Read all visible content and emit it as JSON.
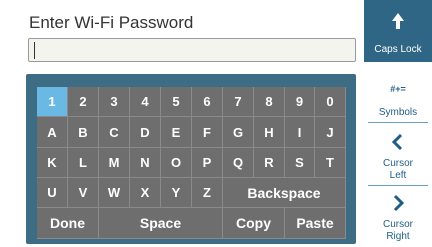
{
  "title": "Enter Wi-Fi Password",
  "password_value": "",
  "keyboard": {
    "row1": [
      "1",
      "2",
      "3",
      "4",
      "5",
      "6",
      "7",
      "8",
      "9",
      "0"
    ],
    "row2": [
      "A",
      "B",
      "C",
      "D",
      "E",
      "F",
      "G",
      "H",
      "I",
      "J"
    ],
    "row3": [
      "K",
      "L",
      "M",
      "N",
      "O",
      "P",
      "Q",
      "R",
      "S",
      "T"
    ],
    "row4": [
      "U",
      "V",
      "W",
      "X",
      "Y",
      "Z"
    ],
    "backspace": "Backspace",
    "done": "Done",
    "space": "Space",
    "copy": "Copy",
    "paste": "Paste"
  },
  "side": {
    "caps_lock": "Caps Lock",
    "symbols_glyph": "#+=",
    "symbols": "Symbols",
    "cursor_left": "Cursor Left",
    "cursor_left_line1": "Cursor",
    "cursor_left_line2": "Left",
    "cursor_right_line1": "Cursor",
    "cursor_right_line2": "Right"
  },
  "icons": {
    "caps": "up-arrow-icon",
    "left": "chevron-left-icon",
    "right": "chevron-right-icon"
  },
  "colors": {
    "panel": "#3c6d84",
    "key": "#6e6e6e",
    "selected_key": "#6ab9e5",
    "side_active": "#2f6685",
    "side_text": "#1f5e84"
  }
}
